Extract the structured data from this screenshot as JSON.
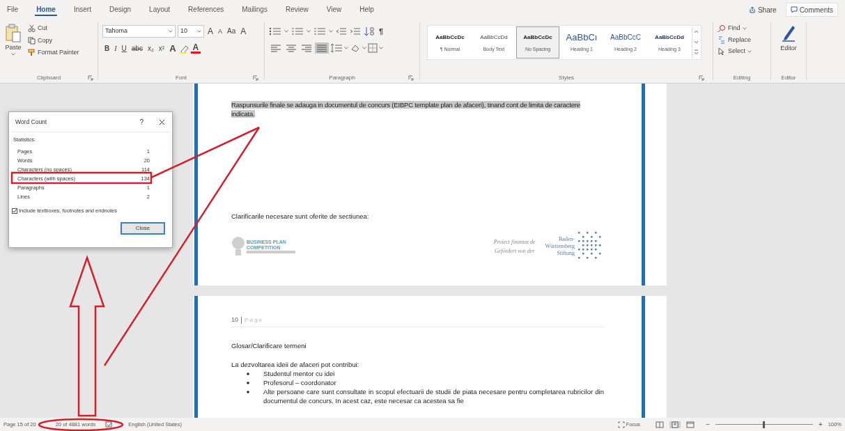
{
  "menu_tabs": [
    {
      "label": "File",
      "selected": false
    },
    {
      "label": "Home",
      "selected": true
    },
    {
      "label": "Insert",
      "selected": false
    },
    {
      "label": "Design",
      "selected": false
    },
    {
      "label": "Layout",
      "selected": false
    },
    {
      "label": "References",
      "selected": false
    },
    {
      "label": "Mailings",
      "selected": false
    },
    {
      "label": "Review",
      "selected": false
    },
    {
      "label": "View",
      "selected": false
    },
    {
      "label": "Help",
      "selected": false
    }
  ],
  "share": "Share",
  "comments": "Comments",
  "clipboard": {
    "paste": "Paste",
    "cut": "Cut",
    "copy": "Copy",
    "format_painter": "Format Painter",
    "label": "Clipboard"
  },
  "font": {
    "name": "Tahoma",
    "size": "10",
    "label": "Font",
    "text_tools": [
      {
        "label": "A",
        "kind": "grow"
      },
      {
        "label": "A",
        "kind": "shrink"
      },
      {
        "label": "Aa",
        "kind": "case"
      },
      {
        "label": "A",
        "kind": "clear"
      }
    ],
    "format_buttons": [
      {
        "label": "B",
        "kind": "bold"
      },
      {
        "label": "I",
        "kind": "italic"
      },
      {
        "label": "U",
        "kind": "underline"
      },
      {
        "label": "abc",
        "kind": "strike"
      },
      {
        "label": "x₂",
        "kind": "sub"
      },
      {
        "label": "x²",
        "kind": "super"
      },
      {
        "label": "A",
        "kind": "effects"
      },
      {
        "label": "A",
        "kind": "color"
      }
    ]
  },
  "paragraph": {
    "label": "Paragraph",
    "marks": "¶",
    "align_buttons": [
      {
        "kind": "left",
        "selected": false
      },
      {
        "kind": "center",
        "selected": false
      },
      {
        "kind": "right",
        "selected": false
      },
      {
        "kind": "justify",
        "selected": true
      }
    ]
  },
  "styles": {
    "label": "Styles",
    "items": [
      {
        "preview": "AaBbCcDc",
        "name": "¶ Normal",
        "kind": "body",
        "selected": false
      },
      {
        "preview": "AaBbCcDd",
        "name": "Body Text",
        "kind": "light",
        "selected": false
      },
      {
        "preview": "AaBbCcDc",
        "name": "No Spacing",
        "kind": "body",
        "selected": true
      },
      {
        "preview": "AaBbCı",
        "name": "Heading 1",
        "kind": "title1",
        "selected": false
      },
      {
        "preview": "AaBbCcC",
        "name": "Heading 2",
        "kind": "title2",
        "selected": false
      },
      {
        "preview": "AaBbCcDd",
        "name": "Heading 3",
        "kind": "title3",
        "selected": false
      }
    ]
  },
  "editing": {
    "find": "Find",
    "replace": "Replace",
    "select": "Select",
    "label": "Editing"
  },
  "editor": {
    "button": "Editor",
    "label": "Editor"
  },
  "word_count": {
    "title": "Word Count",
    "help": "?",
    "section": "Statistics:",
    "rows": [
      {
        "label": "Pages",
        "value": "1"
      },
      {
        "label": "Words",
        "value": "20"
      },
      {
        "label": "Characters (no spaces)",
        "value": "114"
      },
      {
        "label": "Characters (with spaces)",
        "value": "134"
      },
      {
        "label": "Paragraphs",
        "value": "1"
      },
      {
        "label": "Lines",
        "value": "2"
      }
    ],
    "include": {
      "label": "Include textboxes, footnotes and endnotes",
      "checked": true
    },
    "close": "Close"
  },
  "page_1": {
    "selected_text": "Raspunsurile finale se adauga in documentul de concurs (EIBPC template plan de afaceri), tinand cont de limita de caractere indicata.",
    "clarifications": "Clarificarile necesare sunt oferite de sectiunea:",
    "logo_left": "BUSINESS PLAN COMPETITION",
    "funded_by": [
      "Proiect finantat de",
      "Gefördert von der"
    ],
    "logo_right": [
      "Baden-",
      "Württemberg",
      "Stiftung"
    ]
  },
  "page_2": {
    "page_number": "10",
    "page_word": "P a g e",
    "heading": "Glosar/Clarificare termeni",
    "intro": "La dezvoltarea ideii de afaceri pot contribui:",
    "bullets": [
      "Studentul mentor cu idei",
      "Profesorul – coordonator",
      "Alte persoane care sunt consultate in scopul efectuarii de studii de piata necesare pentru completarea rubricilor din documentul de concurs. In acest caz, este necesar ca acestea sa fie"
    ]
  },
  "status_bar": {
    "page": "Page 15 of 20",
    "words": "20 of 4881 words",
    "language": "English (United States)",
    "focus": "Focus",
    "zoom_out": "−",
    "zoom_slider": {
      "level": 0.5
    },
    "zoom_in": "+",
    "zoom": "100%"
  }
}
